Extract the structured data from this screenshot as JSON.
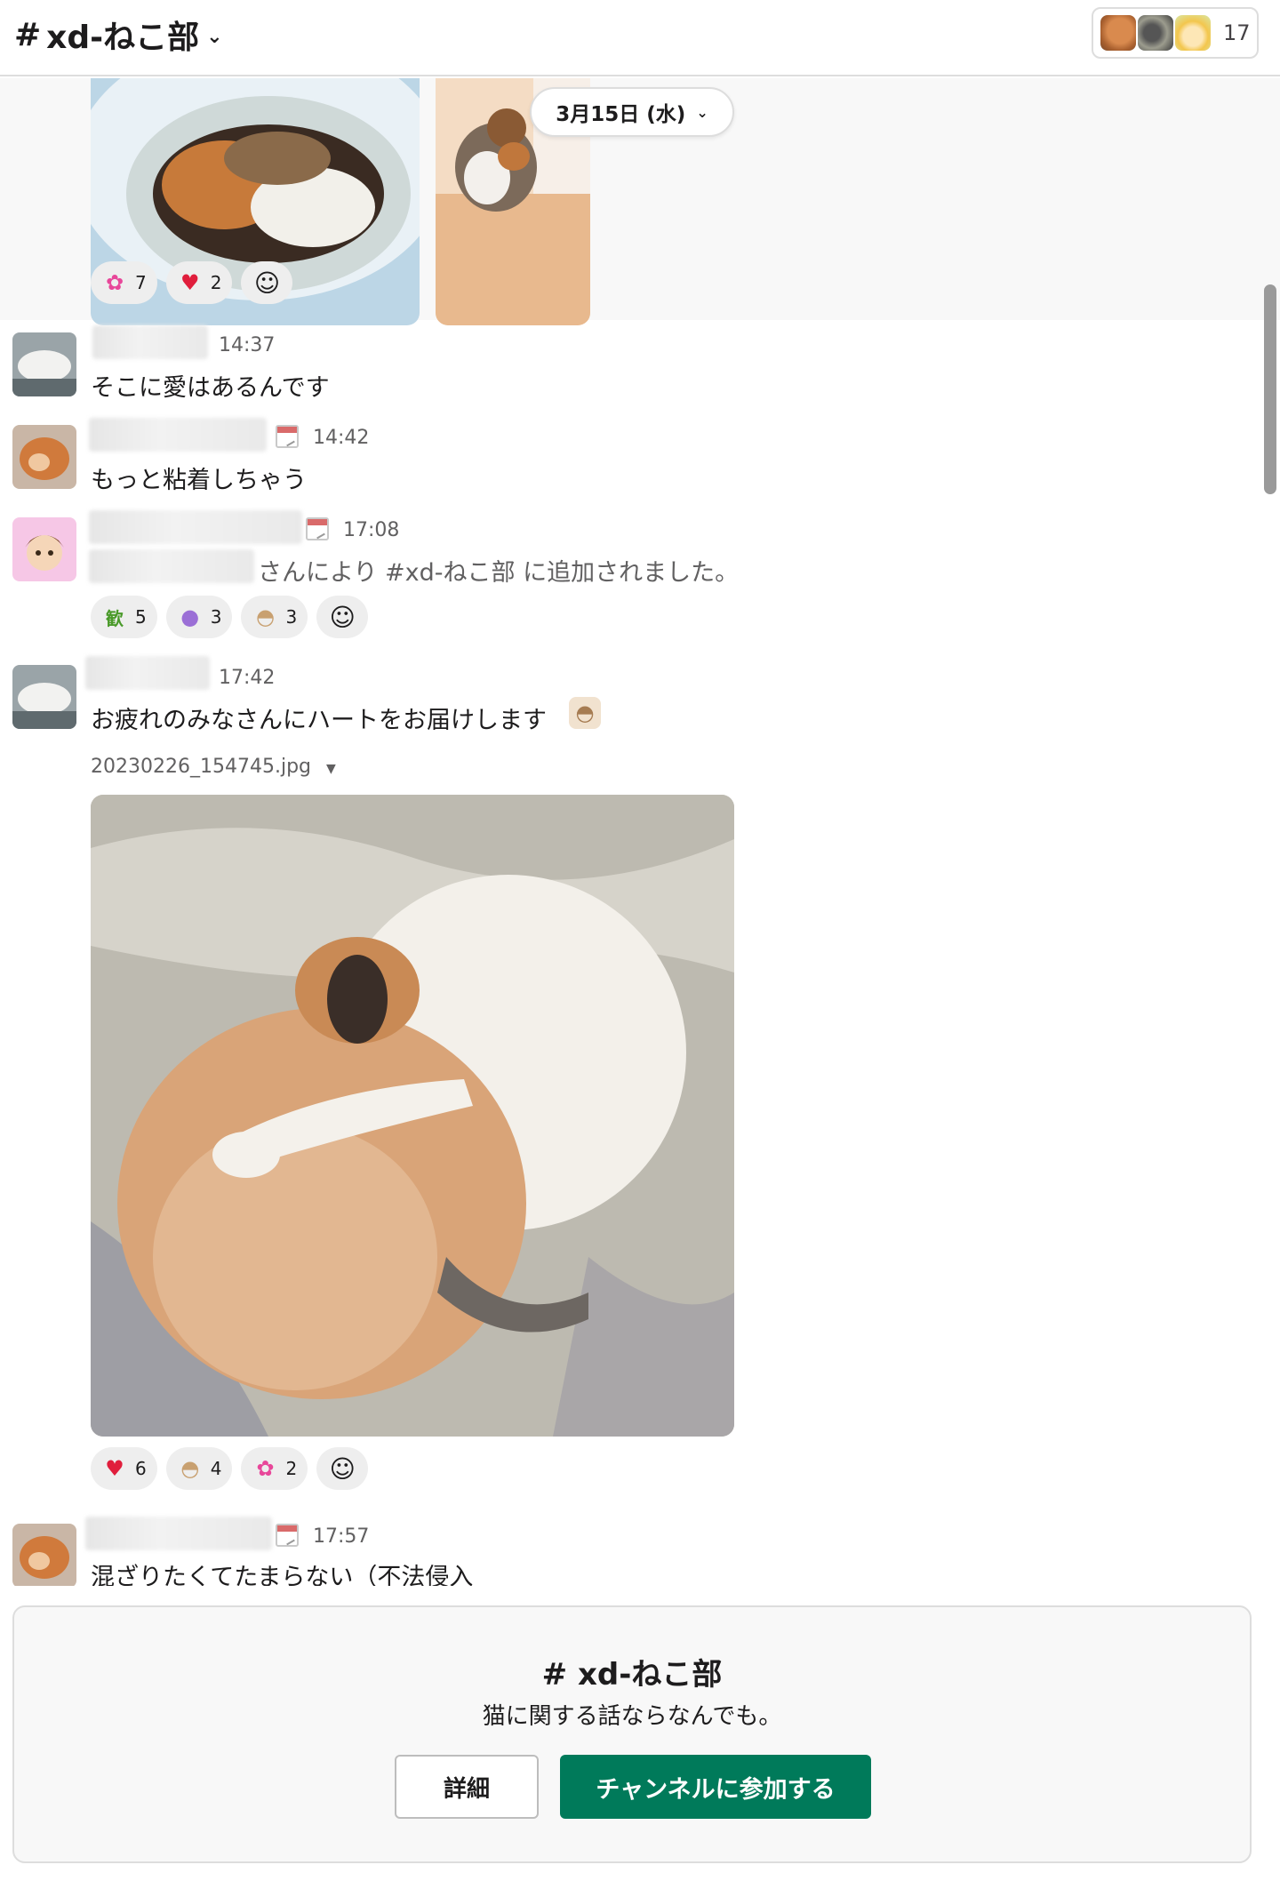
{
  "header": {
    "channel_hash": "#",
    "channel_name": "xd-ねこ部",
    "member_count": "17"
  },
  "date_divider": {
    "label": "3月15日 (水)"
  },
  "top_reactions": [
    {
      "emoji": "party-icon",
      "count": "7"
    },
    {
      "emoji": "heart-icon",
      "count": "2"
    }
  ],
  "messages": [
    {
      "time": "14:37",
      "text": "そこに愛はあるんです"
    },
    {
      "time": "14:42",
      "text": "もっと粘着しちゃう"
    },
    {
      "time": "17:08",
      "text": "さんにより #xd-ねこ部 に追加されました。",
      "reactions": [
        {
          "emoji": "kanji-stamp-icon",
          "count": "5"
        },
        {
          "emoji": "cat-face-icon",
          "count": "3"
        },
        {
          "emoji": "cat-peek-icon",
          "count": "3"
        }
      ]
    },
    {
      "time": "17:42",
      "text": "お疲れのみなさんにハートをお届けします",
      "file_name": "20230226_154745.jpg",
      "reactions": [
        {
          "emoji": "heart-icon",
          "count": "6"
        },
        {
          "emoji": "cat-peek-icon",
          "count": "4"
        },
        {
          "emoji": "party-icon",
          "count": "2"
        }
      ]
    },
    {
      "time": "17:57",
      "text": "混ざりたくてたまらない（不法侵入"
    }
  ],
  "join_panel": {
    "title": "# xd-ねこ部",
    "description": "猫に関する話ならなんでも。",
    "detail_button": "詳細",
    "join_button": "チャンネルに参加する"
  },
  "colors": {
    "join_green": "#007a5a",
    "heart_red": "#e01e3c",
    "link_gray": "#616061"
  }
}
